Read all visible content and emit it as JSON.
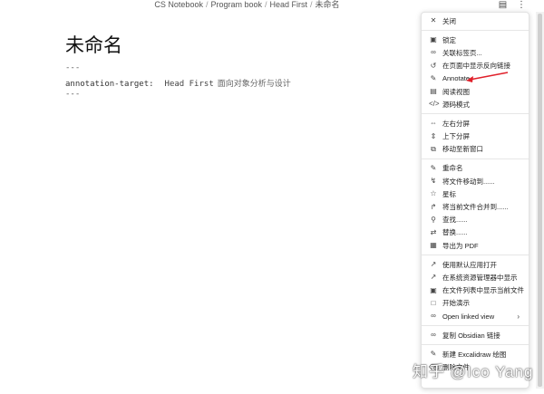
{
  "breadcrumb": [
    "CS Notebook",
    "Program book",
    "Head First",
    "未命名"
  ],
  "top_icons": [
    "book-icon",
    "more-vertical-icon"
  ],
  "doc": {
    "title": "未命名",
    "fm_open": "---",
    "fm_key": "annotation-target:",
    "fm_value": "Head First",
    "fm_value_cjk": "面向对象分析与设计",
    "fm_close": "---"
  },
  "menu": {
    "close": {
      "label": "关闭",
      "icon": "close-icon"
    },
    "g1": [
      {
        "label": "锁定",
        "icon": "lock-icon"
      },
      {
        "label": "关联标签页...",
        "icon": "link-icon"
      },
      {
        "label": "在页面中显示反向链接",
        "icon": "backlink-icon"
      },
      {
        "label": "Annotate",
        "icon": "pencil-icon"
      },
      {
        "label": "阅读视图",
        "icon": "book-open-icon"
      },
      {
        "label": "源码模式",
        "icon": "code-icon"
      }
    ],
    "g2": [
      {
        "label": "左右分屏",
        "icon": "split-horizontal-icon"
      },
      {
        "label": "上下分屏",
        "icon": "split-vertical-icon"
      },
      {
        "label": "移动至新窗口",
        "icon": "new-window-icon"
      }
    ],
    "g3": [
      {
        "label": "重命名",
        "icon": "edit-icon"
      },
      {
        "label": "将文件移动到......",
        "icon": "move-file-icon"
      },
      {
        "label": "星标",
        "icon": "star-icon"
      },
      {
        "label": "将当前文件合并到......",
        "icon": "merge-icon"
      },
      {
        "label": "查找......",
        "icon": "search-icon"
      },
      {
        "label": "替换......",
        "icon": "replace-icon"
      },
      {
        "label": "导出为 PDF",
        "icon": "pdf-icon"
      }
    ],
    "g4": [
      {
        "label": "使用默认应用打开",
        "icon": "external-icon"
      },
      {
        "label": "在系统资源管理器中显示",
        "icon": "reveal-icon"
      },
      {
        "label": "在文件列表中显示当前文件",
        "icon": "folder-icon"
      },
      {
        "label": "开始演示",
        "icon": "presentation-icon"
      },
      {
        "label": "Open linked view",
        "icon": "link-icon",
        "submenu": true
      }
    ],
    "g5": [
      {
        "label": "复制 Obsidian 链接",
        "icon": "link-icon"
      }
    ],
    "g6": [
      {
        "label": "新建 Excalidraw 绘图",
        "icon": "drawing-icon"
      },
      {
        "label": "删除文件",
        "icon": "trash-icon"
      }
    ]
  },
  "arrow_color": "#e0202a",
  "watermark": "知乎 @Ico Yang"
}
